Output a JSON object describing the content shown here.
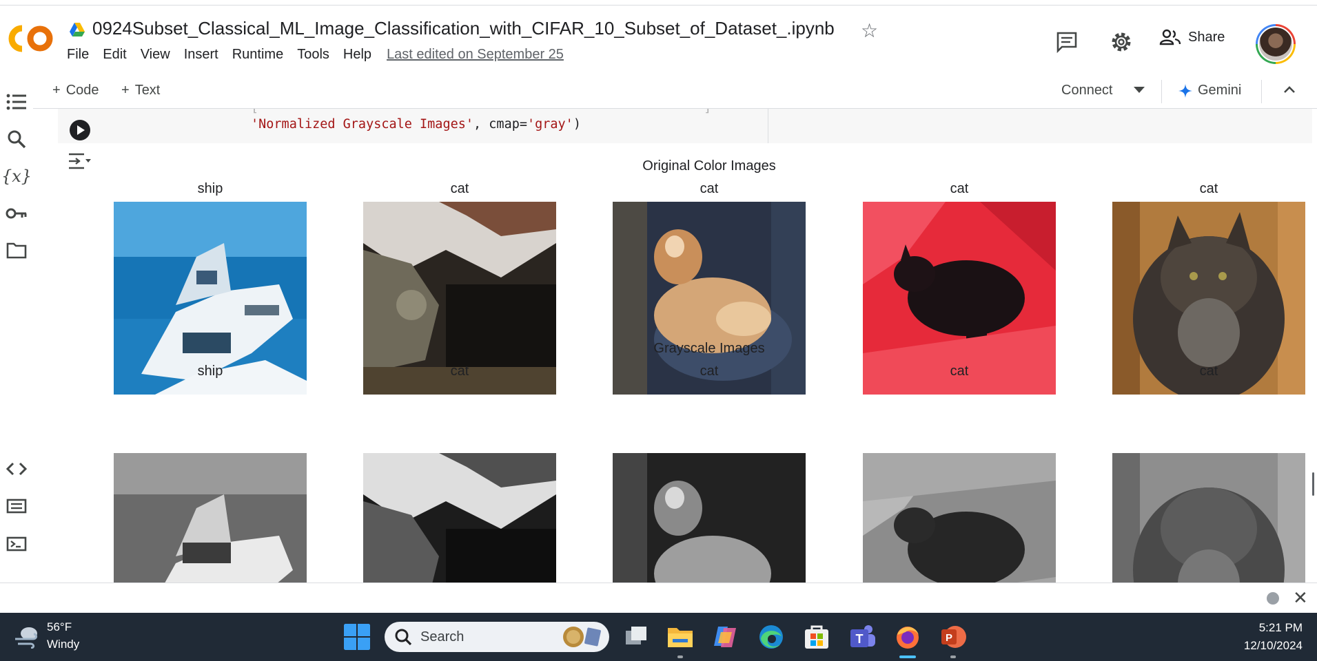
{
  "header": {
    "notebook_title": "0924Subset_Classical_ML_Image_Classification_with_CIFAR_10_Subset_of_Dataset_.ipynb",
    "menu": [
      "File",
      "Edit",
      "View",
      "Insert",
      "Runtime",
      "Tools",
      "Help"
    ],
    "last_edited": "Last edited on September 25",
    "share_label": "Share",
    "icons": [
      "colab-logo",
      "drive-icon",
      "star-icon",
      "comment-icon",
      "gear-icon",
      "share-people-icon",
      "avatar"
    ]
  },
  "toolbar": {
    "add_code": "Code",
    "add_text": "Text",
    "connect": "Connect",
    "gemini": "Gemini"
  },
  "cell": {
    "code_line": "'Normalized Grayscale Images'",
    "code_rest": ", cmap=",
    "code_arg": "'gray'",
    "code_close": ")"
  },
  "output": {
    "color_title": "Original Color Images",
    "gray_title": "Grayscale Images",
    "color_labels": [
      "ship",
      "cat",
      "cat",
      "cat",
      "cat"
    ],
    "gray_labels": [
      "ship",
      "cat",
      "cat",
      "cat",
      "cat"
    ]
  },
  "taskbar": {
    "temperature": "56°F",
    "weather": "Windy",
    "search_label": "Search",
    "time": "5:21 PM",
    "date": "12/10/2024"
  },
  "colors": {
    "colab_orange": "#f9ab00",
    "accent_blue": "#1a73e8",
    "taskbar_bg": "#202a36"
  }
}
